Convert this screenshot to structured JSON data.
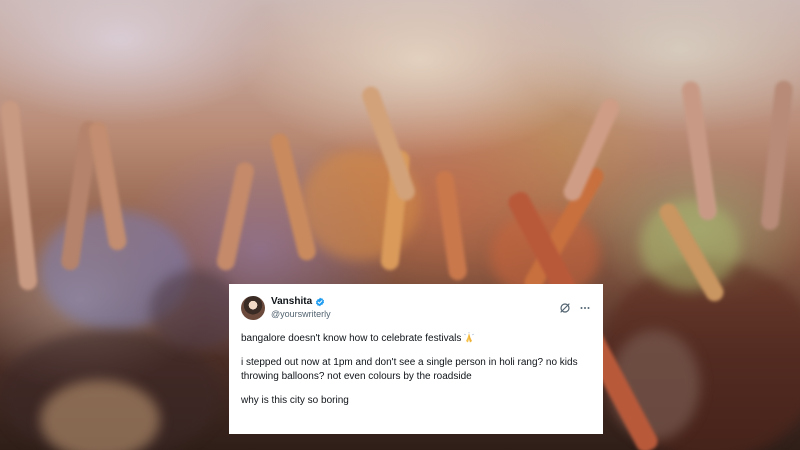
{
  "background": {
    "description_icon": "holi-festival-crowd-photo"
  },
  "tweet": {
    "display_name": "Vanshita",
    "handle": "@yourswriterly",
    "verified": true,
    "line1": "bangalore doesn't know how to celebrate festivals",
    "line1_emoji": "folded-hands-emoji",
    "line2": "i stepped out now at 1pm and don't see a single person in holi rang? no kids throwing balloons? not even colours by the roadside",
    "line3": "why is this city so boring",
    "icons": [
      "grok-icon",
      "more-icon"
    ],
    "verified_color": "#1d9bf0"
  }
}
